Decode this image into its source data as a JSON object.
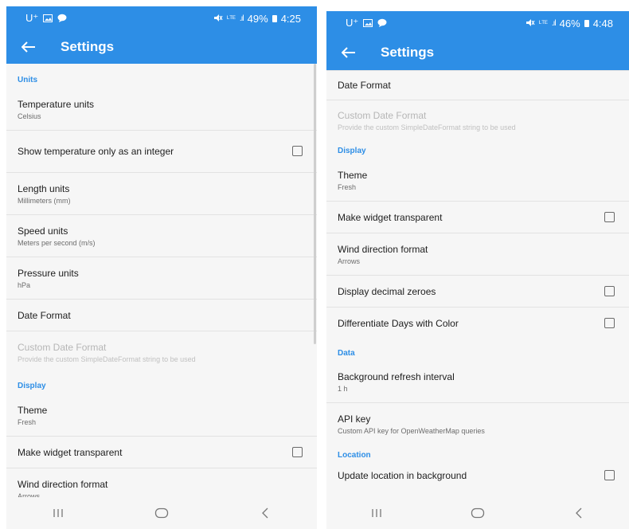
{
  "left": {
    "status": {
      "carrier": "U⁺",
      "battery": "49%",
      "time": "4:25"
    },
    "appbar": {
      "title": "Settings"
    },
    "sections": {
      "units": "Units",
      "display": "Display"
    },
    "items": {
      "temperature": {
        "title": "Temperature units",
        "value": "Celsius"
      },
      "temp_integer": {
        "title": "Show temperature only as an integer"
      },
      "length": {
        "title": "Length units",
        "value": "Millimeters (mm)"
      },
      "speed": {
        "title": "Speed units",
        "value": "Meters per second (m/s)"
      },
      "pressure": {
        "title": "Pressure units",
        "value": "hPa"
      },
      "date_format": {
        "title": "Date Format"
      },
      "custom_date": {
        "title": "Custom Date Format",
        "value": "Provide the custom SimpleDateFormat string to be used"
      },
      "theme": {
        "title": "Theme",
        "value": "Fresh"
      },
      "widget_transparent": {
        "title": "Make widget transparent"
      },
      "wind_direction": {
        "title": "Wind direction format",
        "value": "Arrows"
      }
    }
  },
  "right": {
    "status": {
      "carrier": "U⁺",
      "battery": "46%",
      "time": "4:48"
    },
    "appbar": {
      "title": "Settings"
    },
    "sections": {
      "display": "Display",
      "data": "Data",
      "location": "Location"
    },
    "items": {
      "date_format": {
        "title": "Date Format"
      },
      "custom_date": {
        "title": "Custom Date Format",
        "value": "Provide the custom SimpleDateFormat string to be used"
      },
      "theme": {
        "title": "Theme",
        "value": "Fresh"
      },
      "widget_transparent": {
        "title": "Make widget transparent"
      },
      "wind_direction": {
        "title": "Wind direction format",
        "value": "Arrows"
      },
      "decimal_zeroes": {
        "title": "Display decimal zeroes"
      },
      "days_color": {
        "title": "Differentiate Days with Color"
      },
      "refresh_interval": {
        "title": "Background refresh interval",
        "value": "1 h"
      },
      "api_key": {
        "title": "API key",
        "value": "Custom API key for OpenWeatherMap queries"
      },
      "update_location": {
        "title": "Update location in background"
      }
    }
  },
  "colors": {
    "accent": "#2d8ee6",
    "background": "#f6f6f6"
  },
  "icons": [
    "back-arrow-icon",
    "recent-apps-icon",
    "home-icon",
    "back-nav-icon",
    "checkbox"
  ]
}
